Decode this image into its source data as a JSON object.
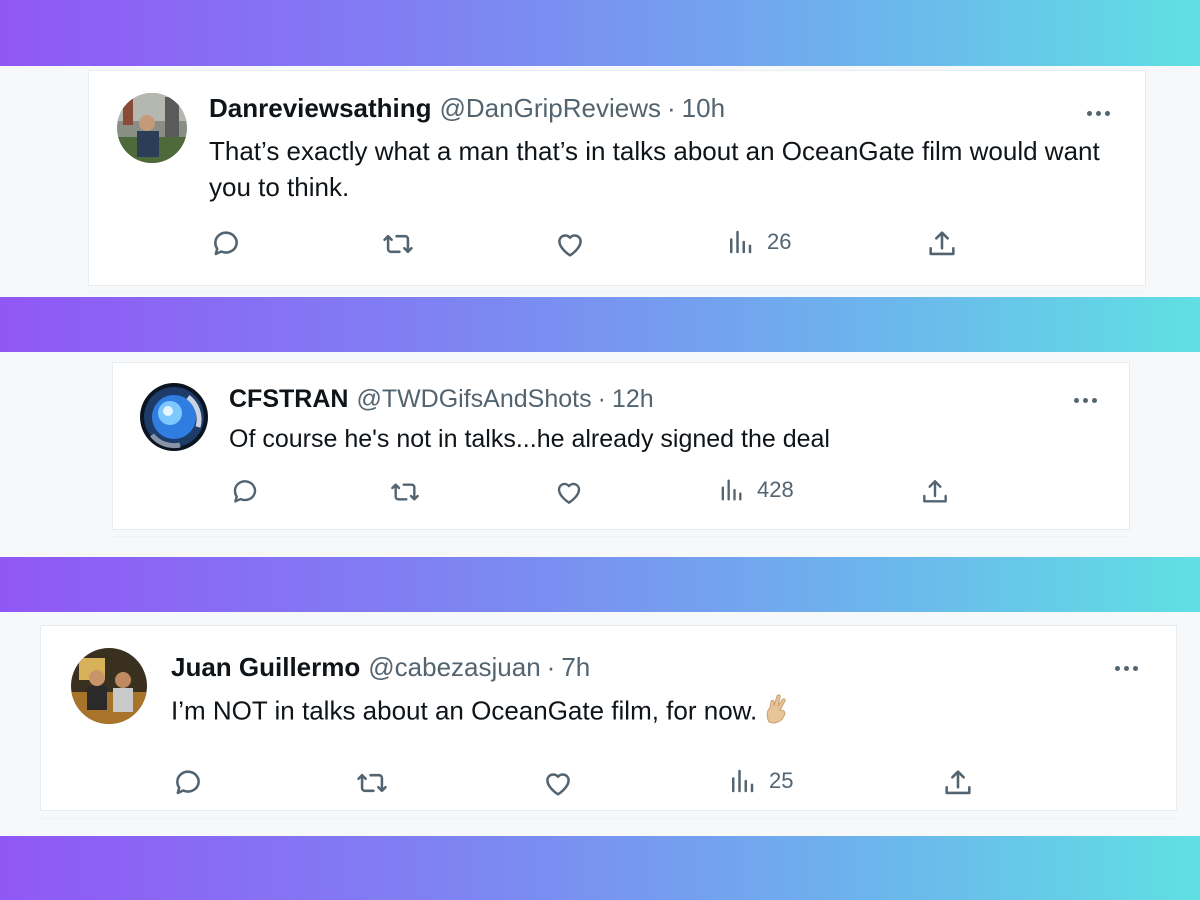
{
  "tweets": [
    {
      "name": "Danreviewsathing",
      "handle": "@DanGripReviews",
      "separator": "·",
      "time": "10h",
      "text": "That’s exactly what a man that’s in talks about an OceanGate film would want you to think.",
      "views": "26",
      "avatar_color": "#6b7a6a"
    },
    {
      "name": "CFSTRAN",
      "handle": "@TWDGifsAndShots",
      "separator": "·",
      "time": "12h",
      "text": "Of course he's not in talks...he already signed the deal",
      "views": "428",
      "avatar_color": "#1a74e8"
    },
    {
      "name": "Juan Guillermo",
      "handle": "@cabezasjuan",
      "separator": "·",
      "time": "7h",
      "text": "I’m NOT in talks about an OceanGate film, for now.",
      "emoji": "crossed-fingers-emoji",
      "views": "25",
      "avatar_color": "#7a5a2a"
    }
  ],
  "colors": {
    "band_gradient": [
      "#9157f5",
      "#7d86f2",
      "#6bb8ec",
      "#5fe0e3"
    ],
    "secondary_text": "#536471",
    "primary_text": "#0f1419"
  },
  "icons": [
    "reply-icon",
    "retweet-icon",
    "like-icon",
    "views-icon",
    "share-icon",
    "more-icon"
  ]
}
